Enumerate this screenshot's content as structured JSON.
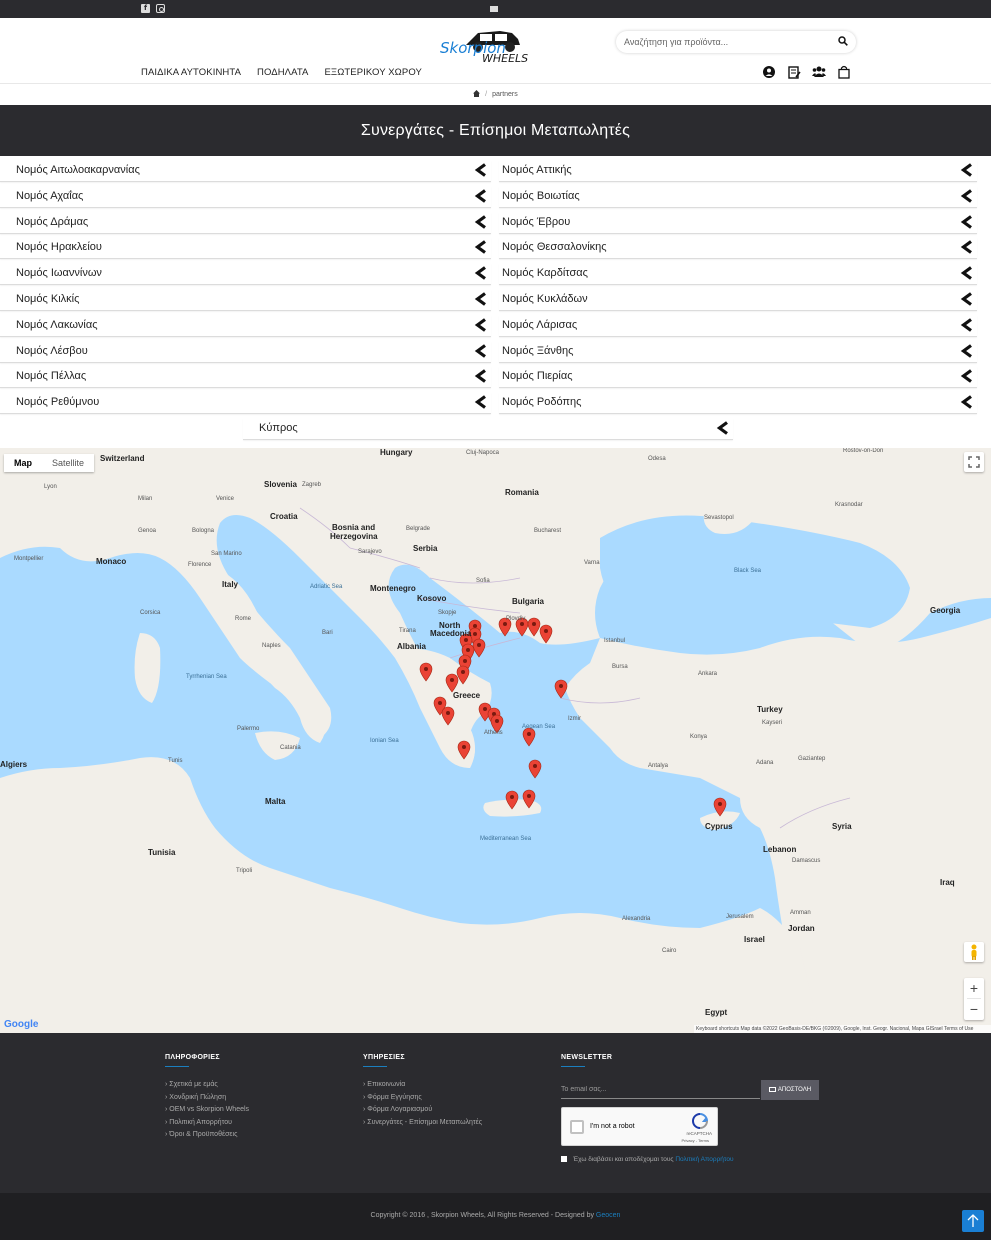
{
  "topbar": {
    "social": [
      "facebook-icon",
      "instagram-icon"
    ],
    "center_icon": "envelope-icon"
  },
  "header": {
    "logo_text_1": "Skorpion",
    "logo_text_2": "WHEELS",
    "search_placeholder": "Αναζήτηση για προϊόντα...",
    "nav": [
      "ΠΑΙΔΙΚΑ ΑΥΤΟΚΙΝΗΤΑ",
      "ΠΟΔΗΛΑΤΑ",
      "ΕΞΩΤΕΡΙΚΟΥ ΧΩΡΟΥ"
    ],
    "icons": [
      "user-icon",
      "note-icon",
      "users-icon",
      "bag-icon"
    ]
  },
  "breadcrumb": {
    "current": "partners"
  },
  "page": {
    "title": "Συνεργάτες - Επίσημοι Μεταπωλητές"
  },
  "regions_left": [
    "Νομός Αιτωλοακαρνανίας",
    "Νομός Αχαΐας",
    "Νομός Δράμας",
    "Νομός Ηρακλείου",
    "Νομός Ιωαννίνων",
    "Νομός Κιλκίς",
    "Νομός Λακωνίας",
    "Νομός Λέσβου",
    "Νομός Πέλλας",
    "Νομός Ρεθύμνου"
  ],
  "regions_right": [
    "Νομός Αττικής",
    "Νομός Βοιωτίας",
    "Νομός Έβρου",
    "Νομός Θεσσαλονίκης",
    "Νομός Καρδίτσας",
    "Νομός Κυκλάδων",
    "Νομός Λάρισας",
    "Νομός Ξάνθης",
    "Νομός Πιερίας",
    "Νομός Ροδόπης"
  ],
  "region_last": "Κύπρος",
  "map": {
    "type_map": "Map",
    "type_satellite": "Satellite",
    "zoom_in": "+",
    "zoom_out": "−",
    "google": "Google",
    "attribution": "Keyboard shortcuts   Map data ©2022 GeoBasis-DE/BKG (©2009), Google, Inst. Geogr. Nacional, Mapa GISrael   Terms of Use",
    "labels": [
      {
        "t": "Switzerland",
        "c": "country"
      },
      {
        "t": "Hungary",
        "c": "country"
      },
      {
        "t": "Slovenia",
        "c": "country"
      },
      {
        "t": "Croatia",
        "c": "country"
      },
      {
        "t": "Bosnia and",
        "c": "country"
      },
      {
        "t": "Herzegovina",
        "c": "country"
      },
      {
        "t": "Serbia",
        "c": "country"
      },
      {
        "t": "Romania",
        "c": "country"
      },
      {
        "t": "Bulgaria",
        "c": "country"
      },
      {
        "t": "Italy",
        "c": "country"
      },
      {
        "t": "Monaco",
        "c": "country"
      },
      {
        "t": "Greece",
        "c": "country"
      },
      {
        "t": "Turkey",
        "c": "country"
      },
      {
        "t": "Syria",
        "c": "country"
      },
      {
        "t": "Iraq",
        "c": "country"
      },
      {
        "t": "Lebanon",
        "c": "country"
      },
      {
        "t": "Israel",
        "c": "country"
      },
      {
        "t": "Jordan",
        "c": "country"
      },
      {
        "t": "Cyprus",
        "c": "country"
      },
      {
        "t": "Malta",
        "c": "country"
      },
      {
        "t": "Tunisia",
        "c": "country"
      },
      {
        "t": "Georgia",
        "c": "country"
      },
      {
        "t": "Kosovo",
        "c": "country"
      },
      {
        "t": "Albania",
        "c": "country"
      },
      {
        "t": "North",
        "c": "country"
      },
      {
        "t": "Macedonia",
        "c": "country"
      },
      {
        "t": "Montenegro",
        "c": "country"
      },
      {
        "t": "Egypt",
        "c": "country"
      },
      {
        "t": "Algiers",
        "c": "country"
      },
      {
        "t": "Black Sea",
        "c": "sea"
      },
      {
        "t": "Mediterranean Sea",
        "c": "sea"
      },
      {
        "t": "Tyrrhenian Sea",
        "c": "sea"
      },
      {
        "t": "Aegean Sea",
        "c": "sea"
      },
      {
        "t": "Adriatic Sea",
        "c": "sea"
      },
      {
        "t": "Ionian Sea",
        "c": "sea"
      },
      {
        "t": "Lyon",
        "c": "city"
      },
      {
        "t": "Milan",
        "c": "city"
      },
      {
        "t": "Venice",
        "c": "city"
      },
      {
        "t": "Zagreb",
        "c": "city"
      },
      {
        "t": "Bologna",
        "c": "city"
      },
      {
        "t": "Florence",
        "c": "city"
      },
      {
        "t": "Genoa",
        "c": "city"
      },
      {
        "t": "San Marino",
        "c": "city"
      },
      {
        "t": "Rome",
        "c": "city"
      },
      {
        "t": "Naples",
        "c": "city"
      },
      {
        "t": "Palermo",
        "c": "city"
      },
      {
        "t": "Catania",
        "c": "city"
      },
      {
        "t": "Tunis",
        "c": "city"
      },
      {
        "t": "Sarajevo",
        "c": "city"
      },
      {
        "t": "Belgrade",
        "c": "city"
      },
      {
        "t": "Sofia",
        "c": "city"
      },
      {
        "t": "Plovdiv",
        "c": "city"
      },
      {
        "t": "Varna",
        "c": "city"
      },
      {
        "t": "Bucharest",
        "c": "city"
      },
      {
        "t": "Istanbul",
        "c": "city"
      },
      {
        "t": "Bursa",
        "c": "city"
      },
      {
        "t": "Izmir",
        "c": "city"
      },
      {
        "t": "Ankara",
        "c": "city"
      },
      {
        "t": "Konya",
        "c": "city"
      },
      {
        "t": "Antalya",
        "c": "city"
      },
      {
        "t": "Adana",
        "c": "city"
      },
      {
        "t": "Kayseri",
        "c": "city"
      },
      {
        "t": "Gaziantep",
        "c": "city"
      },
      {
        "t": "Damascus",
        "c": "city"
      },
      {
        "t": "Alexandria",
        "c": "city"
      },
      {
        "t": "Cairo",
        "c": "city"
      },
      {
        "t": "Jerusalem",
        "c": "city"
      },
      {
        "t": "Amman",
        "c": "city"
      },
      {
        "t": "Odesa",
        "c": "city"
      },
      {
        "t": "Tripoli",
        "c": "city"
      },
      {
        "t": "Tirana",
        "c": "city"
      },
      {
        "t": "Skopje",
        "c": "city"
      },
      {
        "t": "Athens",
        "c": "city"
      },
      {
        "t": "Montpellier",
        "c": "city"
      },
      {
        "t": "Krasnodar",
        "c": "city"
      },
      {
        "t": "Sevastopol",
        "c": "city"
      },
      {
        "t": "Cluj-Napoca",
        "c": "city"
      },
      {
        "t": "Rostov-on-Don",
        "c": "city"
      },
      {
        "t": "Bari",
        "c": "city"
      },
      {
        "t": "Corsica",
        "c": "city"
      }
    ],
    "marker_count": 28
  },
  "footer": {
    "info_title": "ΠΛΗΡΟΦΟΡΙΕΣ",
    "info_links": [
      "Σχετικά με εμάς",
      "Χονδρική Πώληση",
      "OEM vs Skorpion Wheels",
      "Πολιτική Απορρήτου",
      "Όροι & Προϋποθέσεις"
    ],
    "services_title": "ΥΠΗΡΕΣΙΕΣ",
    "services_links": [
      "Επικοινωνία",
      "Φόρμα Εγγύησης",
      "Φόρμα Λογαριασμού",
      "Συνεργάτες - Επίσημοι Μεταπωλητές"
    ],
    "newsletter_title": "NEWSLETTER",
    "email_placeholder": "Το email σας...",
    "send_label": "ΑΠΟΣΤΟΛΗ",
    "recaptcha_text": "I'm not a robot",
    "recaptcha_brand": "reCAPTCHA",
    "recaptcha_links": "Privacy - Terms",
    "consent_text": "Έχω διαβάσει και αποδέχομαι τους",
    "consent_link": "Πολιτική Απορρήτου",
    "copyright": "Copyright © 2016 , Skorpion Wheels, All Rights Reserved - Designed by",
    "designer": "Geocen"
  },
  "colors": {
    "dark": "#2b2b2f",
    "accent_blue": "#1b7fbf",
    "water": "#aadaff",
    "land": "#f2efe9",
    "marker": "#ea4335"
  }
}
